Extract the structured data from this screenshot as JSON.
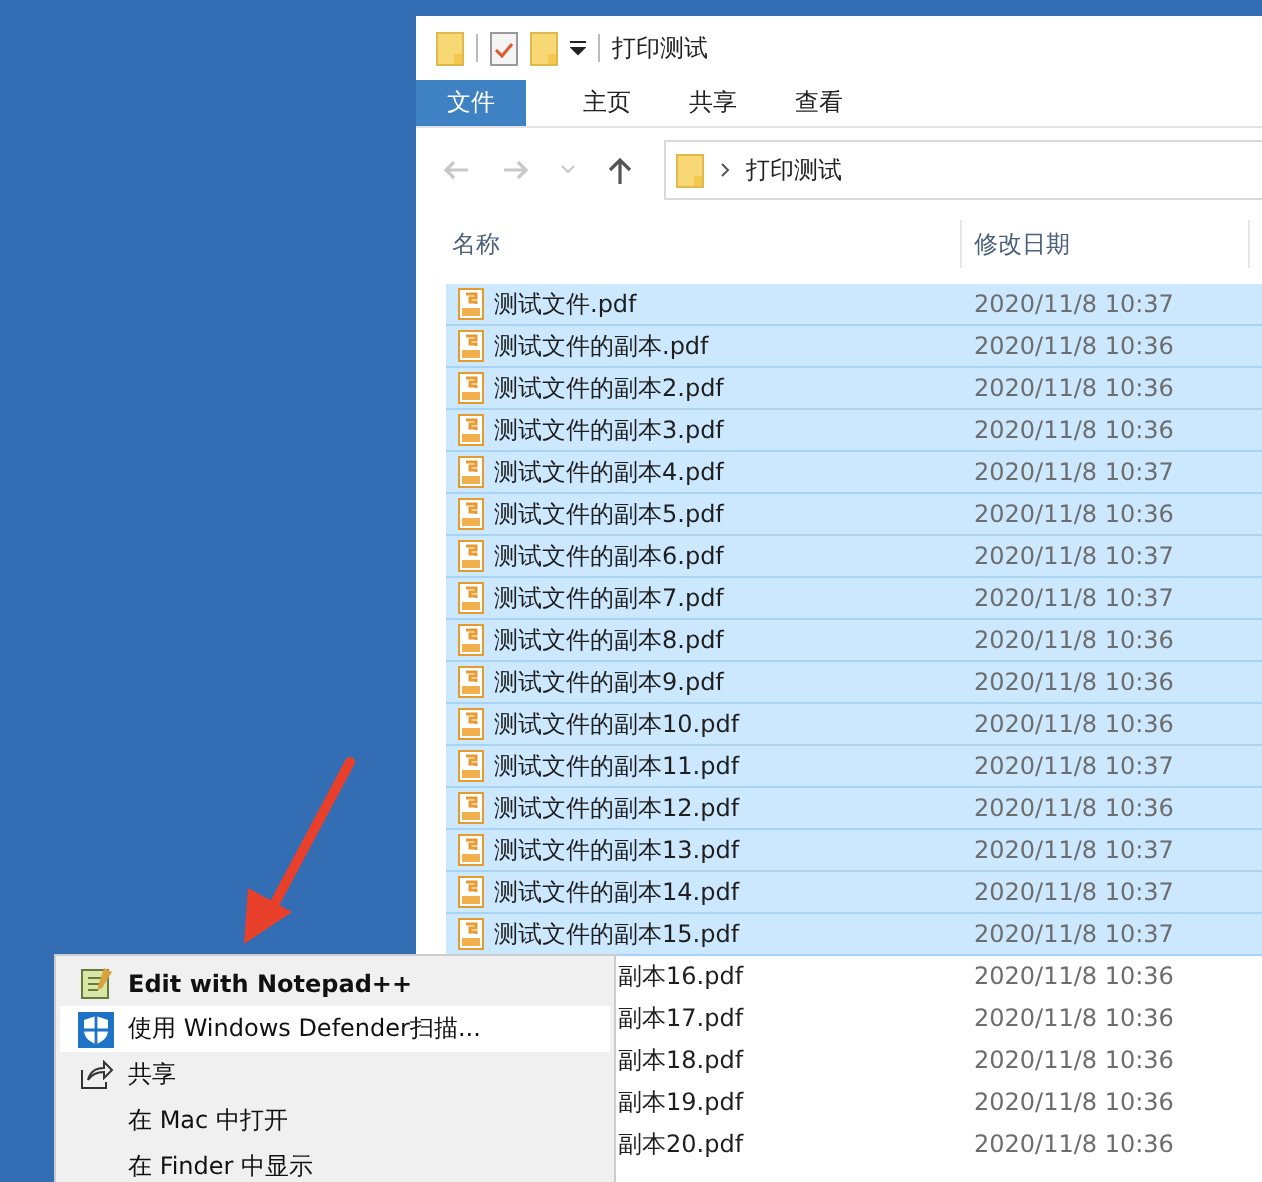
{
  "window": {
    "title": "打印测试"
  },
  "ribbon_tabs": [
    {
      "label": "文件",
      "selected": true
    },
    {
      "label": "主页",
      "selected": false
    },
    {
      "label": "共享",
      "selected": false
    },
    {
      "label": "查看",
      "selected": false
    }
  ],
  "address": {
    "path": "打印测试"
  },
  "columns": [
    "名称",
    "修改日期"
  ],
  "files": [
    {
      "name": "测试文件.pdf",
      "date": "2020/11/8 10:37",
      "selected": true,
      "covered": false
    },
    {
      "name": "测试文件的副本.pdf",
      "date": "2020/11/8 10:36",
      "selected": true,
      "covered": false
    },
    {
      "name": "测试文件的副本2.pdf",
      "date": "2020/11/8 10:36",
      "selected": true,
      "covered": false
    },
    {
      "name": "测试文件的副本3.pdf",
      "date": "2020/11/8 10:36",
      "selected": true,
      "covered": false
    },
    {
      "name": "测试文件的副本4.pdf",
      "date": "2020/11/8 10:37",
      "selected": true,
      "covered": false
    },
    {
      "name": "测试文件的副本5.pdf",
      "date": "2020/11/8 10:36",
      "selected": true,
      "covered": false
    },
    {
      "name": "测试文件的副本6.pdf",
      "date": "2020/11/8 10:37",
      "selected": true,
      "covered": false
    },
    {
      "name": "测试文件的副本7.pdf",
      "date": "2020/11/8 10:37",
      "selected": true,
      "covered": false
    },
    {
      "name": "测试文件的副本8.pdf",
      "date": "2020/11/8 10:36",
      "selected": true,
      "covered": false
    },
    {
      "name": "测试文件的副本9.pdf",
      "date": "2020/11/8 10:36",
      "selected": true,
      "covered": false
    },
    {
      "name": "测试文件的副本10.pdf",
      "date": "2020/11/8 10:36",
      "selected": true,
      "covered": false
    },
    {
      "name": "测试文件的副本11.pdf",
      "date": "2020/11/8 10:37",
      "selected": true,
      "covered": false
    },
    {
      "name": "测试文件的副本12.pdf",
      "date": "2020/11/8 10:36",
      "selected": true,
      "covered": false
    },
    {
      "name": "测试文件的副本13.pdf",
      "date": "2020/11/8 10:37",
      "selected": true,
      "covered": false
    },
    {
      "name": "测试文件的副本14.pdf",
      "date": "2020/11/8 10:37",
      "selected": true,
      "covered": false
    },
    {
      "name": "测试文件的副本15.pdf",
      "date": "2020/11/8 10:37",
      "selected": true,
      "covered": false
    },
    {
      "name": "副本16.pdf",
      "date": "2020/11/8 10:36",
      "selected": false,
      "covered": true
    },
    {
      "name": "副本17.pdf",
      "date": "2020/11/8 10:36",
      "selected": false,
      "covered": true
    },
    {
      "name": "副本18.pdf",
      "date": "2020/11/8 10:36",
      "selected": false,
      "covered": true
    },
    {
      "name": "副本19.pdf",
      "date": "2020/11/8 10:36",
      "selected": false,
      "covered": true
    },
    {
      "name": "副本20.pdf",
      "date": "2020/11/8 10:36",
      "selected": false,
      "covered": true
    }
  ],
  "context_menu": {
    "items": [
      {
        "label": "Edit with Notepad++",
        "kind": "notepad",
        "selected": false
      },
      {
        "label": "使用 Windows Defender扫描...",
        "kind": "defender",
        "selected": true
      },
      {
        "label": "共享",
        "kind": "share",
        "selected": false
      },
      {
        "label": "在 Mac 中打开",
        "kind": "plain",
        "selected": false
      },
      {
        "label": "在 Finder 中显示",
        "kind": "plain",
        "selected": false
      }
    ]
  }
}
